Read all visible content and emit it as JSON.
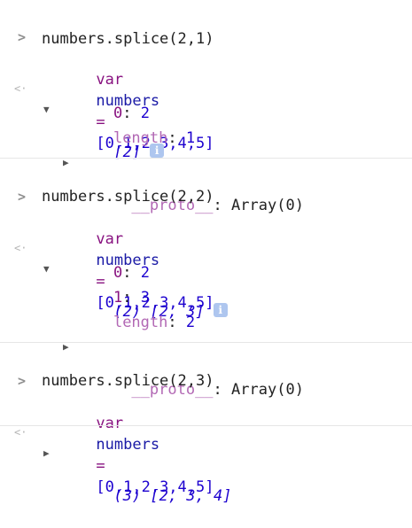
{
  "blocks": [
    {
      "input": {
        "line1": {
          "kw": "var",
          "name": "numbers",
          "op": "=",
          "array": "[0,1,2,3,4,5]"
        },
        "line2": "numbers.splice(2,1)"
      },
      "result": {
        "summary": "[2]",
        "expanded": true,
        "entries": [
          {
            "key": "0",
            "value": "2"
          },
          {
            "key": "length",
            "value": "1"
          }
        ],
        "proto": {
          "key": "__proto__",
          "value": "Array(0)"
        }
      }
    },
    {
      "input": {
        "line1": {
          "kw": "var",
          "name": "numbers",
          "op": "=",
          "array": "[0,1,2,3,4,5]"
        },
        "line2": "numbers.splice(2,2)"
      },
      "result": {
        "summary": "(2) [2, 3]",
        "expanded": true,
        "entries": [
          {
            "key": "0",
            "value": "2"
          },
          {
            "key": "1",
            "value": "3"
          },
          {
            "key": "length",
            "value": "2"
          }
        ],
        "proto": {
          "key": "__proto__",
          "value": "Array(0)"
        }
      }
    },
    {
      "input": {
        "line1": {
          "kw": "var",
          "name": "numbers",
          "op": "=",
          "array": "[0,1,2,3,4,5]"
        },
        "line2": "numbers.splice(2,3)"
      },
      "result": {
        "summary": "(3) [2, 3, 4]",
        "expanded": false
      }
    }
  ],
  "icons": {
    "prompt": "chevron-right-icon",
    "result": "return-arrow-icon",
    "expanded": "triangle-down-icon",
    "collapsed": "triangle-right-icon",
    "info": "info-icon"
  },
  "glyphs": {
    "prompt": ">",
    "result": "<·",
    "expanded": "▼",
    "collapsed": "▶",
    "info": "i",
    "colon": ":"
  },
  "colors": {
    "keyword": "#881280",
    "number": "#1c00cf",
    "info_badge": "#aec6ef",
    "separator": "#e6e6e6"
  }
}
